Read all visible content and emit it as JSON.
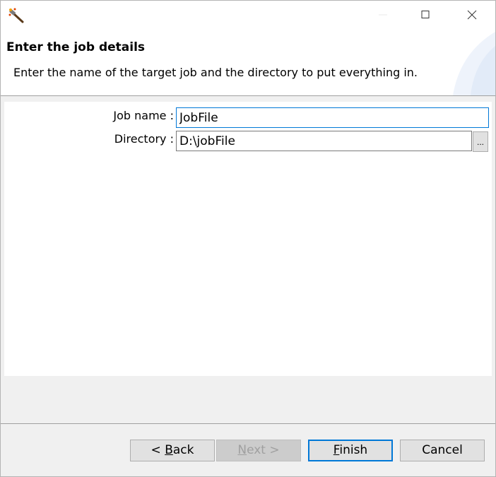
{
  "window": {
    "title": "",
    "controls": {
      "minimize": "minimize-icon",
      "maximize": "maximize-icon",
      "close": "close-icon"
    }
  },
  "banner": {
    "title": "Enter the job details",
    "description": "Enter the name of the target job and the directory to put everything in."
  },
  "form": {
    "job_name_label": "Job name :",
    "job_name_value": "JobFile",
    "directory_label": "Directory :",
    "directory_value": "D:\\jobFile",
    "browse_label": "..."
  },
  "buttons": {
    "back": {
      "prefix": "< ",
      "mnemonic": "B",
      "rest": "ack"
    },
    "next": {
      "mnemonic": "N",
      "rest": "ext >"
    },
    "finish": {
      "mnemonic": "F",
      "rest": "inish"
    },
    "cancel": "Cancel"
  },
  "colors": {
    "focus": "#0078d7",
    "background": "#f0f0f0",
    "content": "#ffffff"
  }
}
